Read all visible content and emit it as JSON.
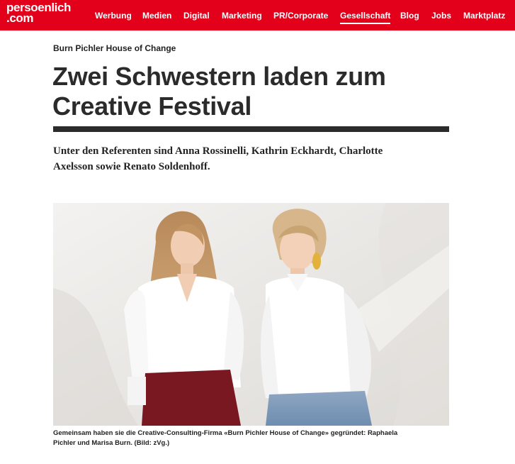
{
  "header": {
    "logo_line1": "persoenlich",
    "logo_line2": ".com",
    "nav": [
      {
        "label": "Werbung"
      },
      {
        "label": "Medien"
      },
      {
        "label": "Digital"
      },
      {
        "label": "Marketing"
      },
      {
        "label": "PR/Corporate"
      },
      {
        "label": "Gesellschaft",
        "active": true
      },
      {
        "label": "Blog"
      },
      {
        "label": "Jobs"
      },
      {
        "label": "Marktplatz"
      }
    ]
  },
  "article": {
    "kicker": "Burn Pichler House of Change",
    "title_line1": "Zwei Schwestern laden zum",
    "title_line2": "Creative Festival",
    "lead_line1": "Unter den Referenten sind Anna Rossinelli, Kathrin Eckhardt, Charlotte",
    "lead_line2": "Axelsson sowie Renato Soldenhoff.",
    "caption_line1": "Gemeinsam haben sie die Creative-Consulting-Firma «Burn Pichler House of Change» gegründet: Raphaela",
    "caption_line2": "Pichler und Marisa Burn. (Bild: zVg.)"
  },
  "colors": {
    "brand_red": "#e2001a",
    "text_dark": "#2b2b2b"
  }
}
